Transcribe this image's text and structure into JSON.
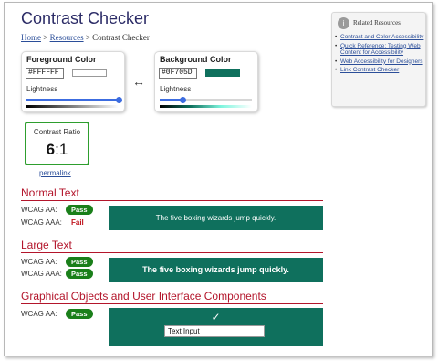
{
  "header": {
    "title": "Contrast Checker",
    "breadcrumb": {
      "home": "Home",
      "sep1": ">",
      "resources": "Resources",
      "sep2": ">",
      "current": "Contrast Checker"
    }
  },
  "foreground": {
    "title": "Foreground Color",
    "hex_value": "#FFFFFF",
    "swatch_color": "#FFFFFF",
    "lightness_label": "Lightness",
    "lightness_fraction": 1.0
  },
  "swap_symbol": "↔",
  "background": {
    "title": "Background Color",
    "hex_value": "#0F705D",
    "swatch_color": "#0F705D",
    "lightness_label": "Lightness",
    "lightness_fraction": 0.25
  },
  "resources": {
    "icon": "info-icon",
    "title": "Related Resources",
    "links": [
      "Contrast and Color Accessibility",
      "Quick Reference: Testing Web Content for Accessibility",
      "Web Accessibility for Designers",
      "Link Contrast Checker"
    ]
  },
  "ratio": {
    "label": "Contrast Ratio",
    "value": "6",
    "suffix": ":1"
  },
  "permalink": "permalink",
  "sections": {
    "normal": {
      "title": "Normal Text",
      "aa_label": "WCAG AA:",
      "aa_result": "Pass",
      "aaa_label": "WCAG AAA:",
      "aaa_result": "Fail",
      "preview": "The five boxing wizards jump quickly."
    },
    "large": {
      "title": "Large Text",
      "aa_label": "WCAG AA:",
      "aa_result": "Pass",
      "aaa_label": "WCAG AAA:",
      "aaa_result": "Pass",
      "preview": "The five boxing wizards jump quickly."
    },
    "graphics": {
      "title": "Graphical Objects and User Interface Components",
      "aa_label": "WCAG AA:",
      "aa_result": "Pass",
      "check_icon": "checkmark-icon",
      "check_glyph": "✓",
      "input_value": "Text Input"
    }
  },
  "colors": {
    "title": "#2B2B66",
    "link": "#2B4E99",
    "section_red": "#B3152B",
    "pass_green": "#1A7F1A",
    "ratio_border": "#2E9E2E",
    "slider_blue": "#3C6CE0"
  }
}
